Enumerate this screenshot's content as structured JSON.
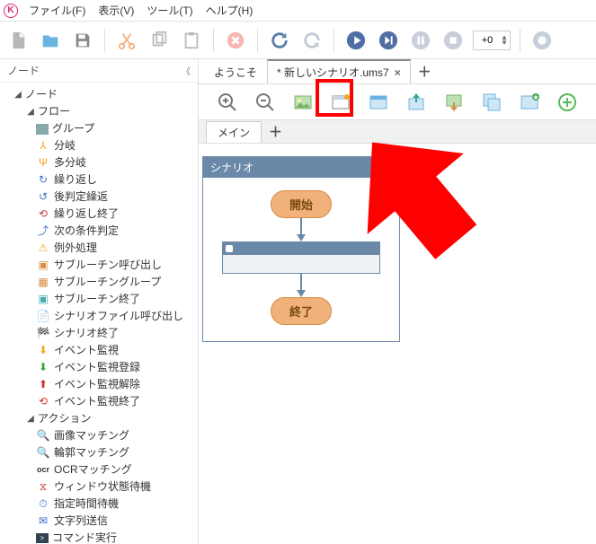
{
  "app_icon_letter": "K",
  "menus": {
    "file": "ファイル(F)",
    "view": "表示(V)",
    "tool": "ツール(T)",
    "help": "ヘルプ(H)"
  },
  "speed_spin": "+0",
  "side_panel_title": "ノード",
  "tree": {
    "root": "ノード",
    "flow": {
      "label": "フロー",
      "items": [
        {
          "icon": "group",
          "label": "グループ"
        },
        {
          "icon": "branch",
          "label": "分岐"
        },
        {
          "icon": "multibranch",
          "label": "多分岐"
        },
        {
          "icon": "loop",
          "label": "繰り返し"
        },
        {
          "icon": "postloop",
          "label": "後判定繰返"
        },
        {
          "icon": "loopend",
          "label": "繰り返し終了"
        },
        {
          "icon": "nextcond",
          "label": "次の条件判定"
        },
        {
          "icon": "except",
          "label": "例外処理"
        },
        {
          "icon": "subcall",
          "label": "サブルーチン呼び出し"
        },
        {
          "icon": "subgroup",
          "label": "サブルーチングループ"
        },
        {
          "icon": "subend",
          "label": "サブルーチン終了"
        },
        {
          "icon": "scenfile",
          "label": "シナリオファイル呼び出し"
        },
        {
          "icon": "scenend",
          "label": "シナリオ終了"
        },
        {
          "icon": "evwatch",
          "label": "イベント監視"
        },
        {
          "icon": "evreg",
          "label": "イベント監視登録"
        },
        {
          "icon": "evunreg",
          "label": "イベント監視解除"
        },
        {
          "icon": "evend",
          "label": "イベント監視終了"
        }
      ]
    },
    "action": {
      "label": "アクション",
      "items": [
        {
          "icon": "imgmatch",
          "label": "画像マッチング"
        },
        {
          "icon": "edgematch",
          "label": "輪郭マッチング"
        },
        {
          "icon": "ocr",
          "label": "OCRマッチング"
        },
        {
          "icon": "winwait",
          "label": "ウィンドウ状態待機"
        },
        {
          "icon": "timewait",
          "label": "指定時間待機"
        },
        {
          "icon": "strsend",
          "label": "文字列送信"
        },
        {
          "icon": "cmd",
          "label": "コマンド実行"
        }
      ]
    }
  },
  "tabs": {
    "welcome": "ようこそ",
    "new": "* 新しいシナリオ.ums7"
  },
  "subtabs": {
    "main": "メイン"
  },
  "scenario": {
    "title": "シナリオ",
    "start": "開始",
    "end": "終了"
  }
}
